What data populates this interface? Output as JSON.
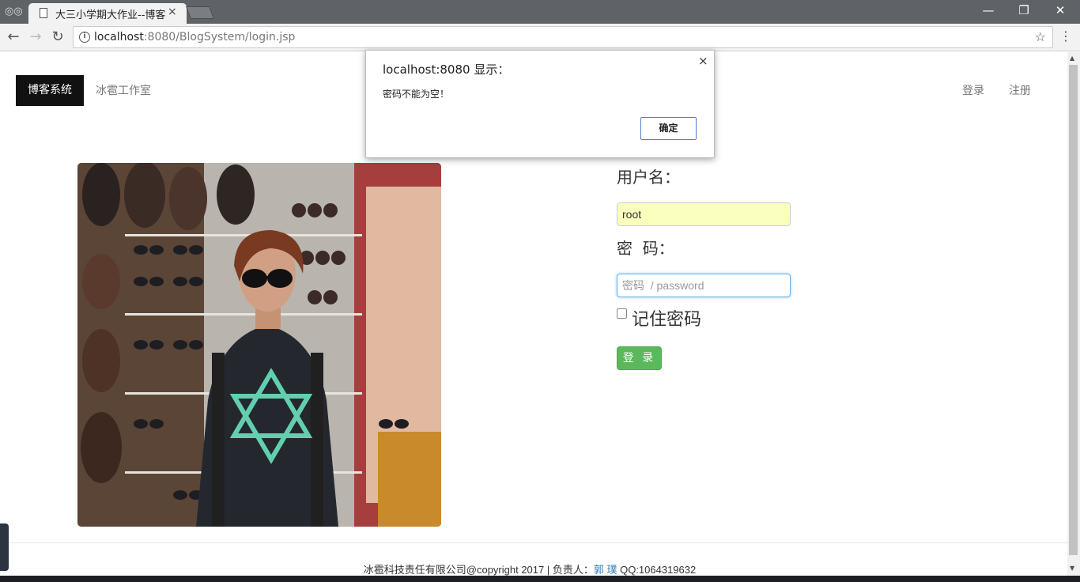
{
  "browser": {
    "tab_title": "大三小学期大作业--博客",
    "url_host": "localhost",
    "url_rest": ":8080/BlogSystem/login.jsp",
    "close_glyph": "×",
    "minimize_glyph": "—",
    "restore_glyph": "❐",
    "window_close_glyph": "✕"
  },
  "navbar": {
    "brand": "博客系统",
    "studio": "冰雹工作室",
    "login": "登录",
    "register": "注册"
  },
  "form": {
    "username_label": "用户名：",
    "username_value": "root",
    "password_label": "密  码：",
    "password_placeholder": "密码  / password",
    "remember_label": "记住密码",
    "login_button": "登 录"
  },
  "footer": {
    "text_before": "冰雹科技责任有限公司@copyright 2017 | 负责人：",
    "link": "郭 璞",
    "text_after": " QQ:1064319632"
  },
  "dialog": {
    "title": "localhost:8080 显示：",
    "message": "密码不能为空！",
    "ok": "确定",
    "close": "×"
  },
  "colors": {
    "brand_bg": "#111111",
    "login_button": "#5cb85c",
    "autofill": "#faffbd",
    "focus": "#66afe9",
    "link": "#337ab7"
  }
}
